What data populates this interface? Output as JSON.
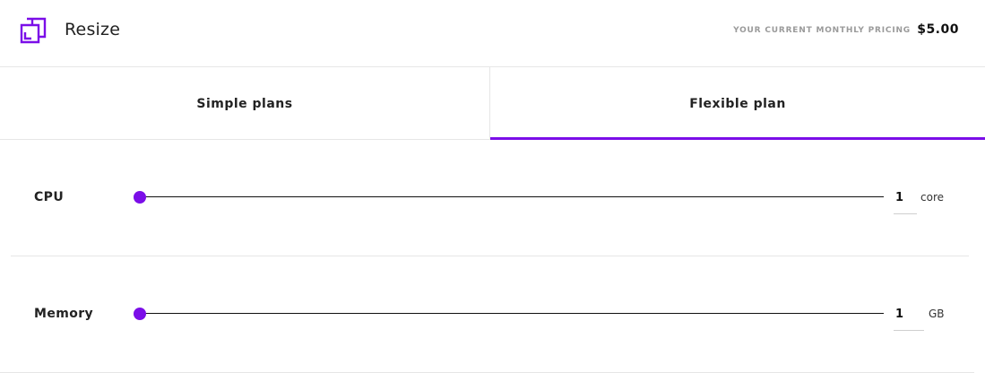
{
  "header": {
    "title": "Resize",
    "icon": "resize-icon",
    "pricing_label": "YOUR CURRENT MONTHLY PRICING",
    "pricing_value": "$5.00"
  },
  "tabs": [
    {
      "label": "Simple plans",
      "active": false
    },
    {
      "label": "Flexible plan",
      "active": true
    }
  ],
  "accent_color": "#7b0ee8",
  "resources": {
    "cpu": {
      "label": "CPU",
      "value": "1",
      "unit": "core",
      "slider_fraction": 0
    },
    "memory": {
      "label": "Memory",
      "value": "1",
      "unit": "GB",
      "slider_fraction": 0
    }
  }
}
